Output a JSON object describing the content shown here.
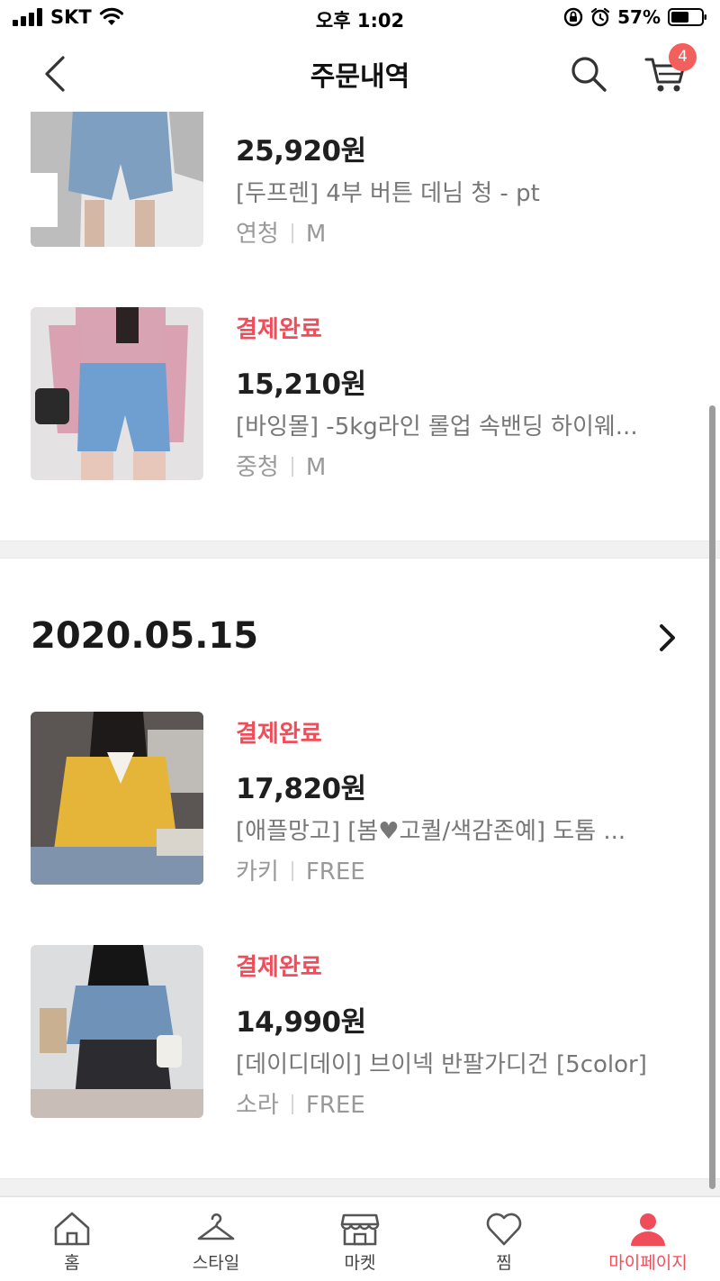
{
  "status_bar": {
    "carrier": "SKT",
    "time": "오후 1:02",
    "battery": "57%"
  },
  "header": {
    "title": "주문내역",
    "cart_count": "4"
  },
  "orders": [
    {
      "items": [
        {
          "status": "",
          "price": "25,920원",
          "name": "[두프렌] 4부 버튼 데님 청 - pt",
          "color": "연청",
          "size": "M"
        },
        {
          "status": "결제완료",
          "price": "15,210원",
          "name": "[바잉몰] -5kg라인 롤업 속밴딩 하이웨...",
          "color": "중청",
          "size": "M"
        }
      ]
    },
    {
      "date": "2020.05.15",
      "items": [
        {
          "status": "결제완료",
          "price": "17,820원",
          "name": "[애플망고] [봄♥고퀄/색감존예] 도톰 ...",
          "color": "카키",
          "size": "FREE"
        },
        {
          "status": "결제완료",
          "price": "14,990원",
          "name": "[데이디데이] 브이넥 반팔가디건 [5color]",
          "color": "소라",
          "size": "FREE"
        }
      ]
    }
  ],
  "tabs": [
    {
      "label": "홈",
      "icon": "home-icon"
    },
    {
      "label": "스타일",
      "icon": "hanger-icon"
    },
    {
      "label": "마켓",
      "icon": "store-icon"
    },
    {
      "label": "찜",
      "icon": "heart-icon"
    },
    {
      "label": "마이페이지",
      "icon": "person-icon",
      "active": true
    }
  ],
  "colors": {
    "accent": "#ef4d5a",
    "badge": "#f25f5c"
  }
}
